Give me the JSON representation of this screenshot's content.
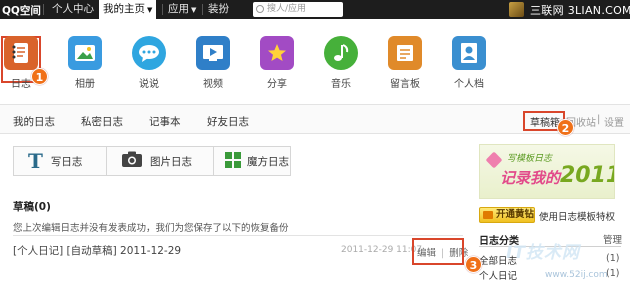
{
  "topbar": {
    "logo": "QQ空间",
    "nav": [
      "个人中心",
      "我的主页",
      "应用",
      "装扮"
    ],
    "active_nav": "我的主页",
    "search_placeholder": "搜人/应用",
    "watermark": "三联网 3LIAN.COM"
  },
  "apps": [
    {
      "label": "日志",
      "icon": "notebook-icon",
      "color": "#d9632b"
    },
    {
      "label": "相册",
      "icon": "photo-icon",
      "color": "#3a9be0"
    },
    {
      "label": "说说",
      "icon": "chat-bubble-icon",
      "color": "#2fa6e0"
    },
    {
      "label": "视频",
      "icon": "video-icon",
      "color": "#2f7fc8"
    },
    {
      "label": "分享",
      "icon": "star-icon",
      "color": "#a24bc4"
    },
    {
      "label": "音乐",
      "icon": "music-note-icon",
      "color": "#46b03a"
    },
    {
      "label": "留言板",
      "icon": "message-board-icon",
      "color": "#e08a2a"
    },
    {
      "label": "个人档",
      "icon": "profile-icon",
      "color": "#3a8fd0"
    }
  ],
  "badges": [
    "1",
    "2",
    "3"
  ],
  "tabs": [
    "我的日志",
    "私密日志",
    "记事本",
    "好友日志"
  ],
  "right_links": {
    "draft": "草稿箱",
    "recycle": "回收站",
    "separator": "|",
    "settings": "设置"
  },
  "write_buttons": [
    {
      "label": "写日志",
      "icon": "text-t-icon"
    },
    {
      "label": "图片日志",
      "icon": "camera-icon"
    },
    {
      "label": "魔方日志",
      "icon": "grid-icon"
    }
  ],
  "drafts": {
    "title": "草稿(0)",
    "info": "您上次编辑日志并没有发表成功，我们为您保存了以下的恢复备份",
    "row": {
      "text": "[个人日记] [自动草稿]  2011-12-29",
      "date": "2011-12-29 11:07",
      "edit": "编辑",
      "sep": "|",
      "delete": "删除"
    }
  },
  "sidebar": {
    "banner_line1": "写模板日志",
    "banner_line2": "记录我的",
    "banner_year": "2011",
    "vip_button": "开通黄钻",
    "vip_text": "使用日志模板特权",
    "category_title": "日志分类",
    "manage": "管理",
    "categories": [
      {
        "name": "全部日志",
        "count": "(1)"
      },
      {
        "name": "个人日记",
        "count": "(1)"
      }
    ]
  },
  "watermark_bottom": "IT技术网",
  "watermark_url": "www.52ij.com"
}
